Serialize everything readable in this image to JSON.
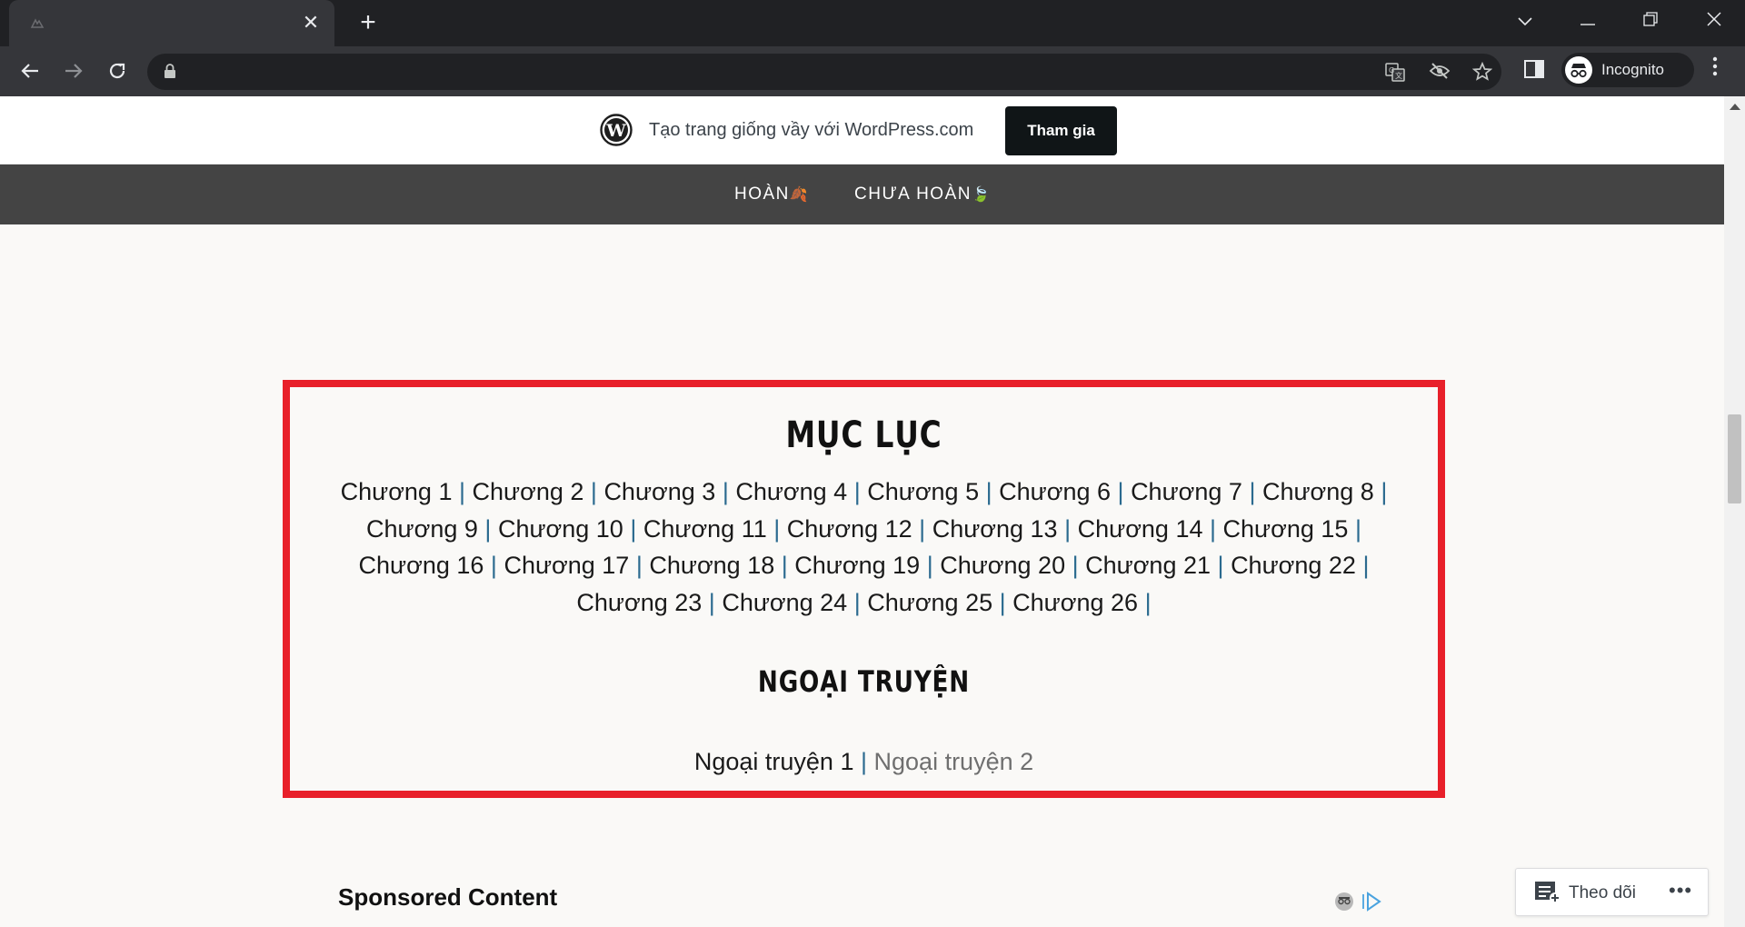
{
  "browser": {
    "new_tab_symbol": "+",
    "close_tab_symbol": "✕",
    "window_controls": [
      "⌄",
      "—",
      "❐",
      "✕"
    ],
    "incognito_label": "Incognito",
    "url": ""
  },
  "wp_banner": {
    "text": "Tạo trang giống vầy với WordPress.com",
    "join_button": "Tham gia"
  },
  "menu": {
    "items": [
      {
        "label": "HOÀN",
        "icon": "🍂"
      },
      {
        "label": "CHƯA HOÀN",
        "icon": "🍃"
      }
    ]
  },
  "toc": {
    "title": "MỤC LỤC",
    "separator": "|",
    "chapters": [
      "Chương 1",
      "Chương 2",
      "Chương 3",
      "Chương 4",
      "Chương 5",
      "Chương 6",
      "Chương 7",
      "Chương 8",
      "Chương 9",
      "Chương 10",
      "Chương 11",
      "Chương 12",
      "Chương 13",
      "Chương 14",
      "Chương 15",
      "Chương 16",
      "Chương 17",
      "Chương 18",
      "Chương 19",
      "Chương 20",
      "Chương 21",
      "Chương 22",
      "Chương 23",
      "Chương 24",
      "Chương 25",
      "Chương 26"
    ],
    "extra_title": "NGOẠI TRUYỆN",
    "extras": [
      "Ngoại truyện 1",
      "Ngoại truyện 2"
    ]
  },
  "sponsored": {
    "title": "Sponsored Content"
  },
  "follow_widget": {
    "label": "Theo dõi",
    "more": "•••"
  },
  "colors": {
    "border_accent": "#e8202a",
    "menu_bg": "#444444",
    "separator": "#2b6a8f"
  }
}
